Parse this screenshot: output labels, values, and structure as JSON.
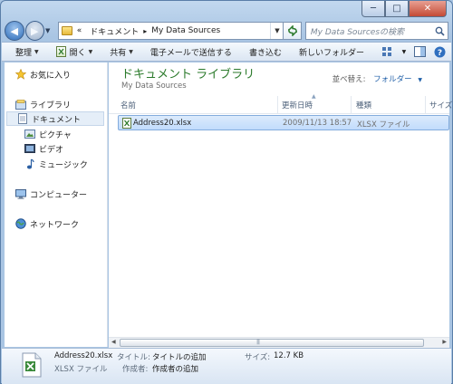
{
  "window": {
    "caption": {
      "minimize": "─",
      "maximize": "□",
      "close": "✕"
    }
  },
  "nav": {
    "back_icon": "back-arrow-icon",
    "forward_icon": "forward-arrow-icon",
    "address": {
      "prefix": "«",
      "crumb1": "ドキュメント",
      "sep": "▸",
      "crumb2": "My Data Sources"
    },
    "search_placeholder": "My Data Sourcesの検索"
  },
  "toolbar": {
    "organize": "整理",
    "open": "開く",
    "share": "共有",
    "email": "電子メールで送信する",
    "burn": "書き込む",
    "new_folder": "新しいフォルダー"
  },
  "sidebar": {
    "favorites": "お気に入り",
    "libraries": "ライブラリ",
    "documents": "ドキュメント",
    "pictures": "ピクチャ",
    "videos": "ビデオ",
    "music": "ミュージック",
    "computer": "コンピューター",
    "network": "ネットワーク"
  },
  "content": {
    "library_title": "ドキュメント ライブラリ",
    "library_subtitle": "My Data Sources",
    "arrange_label": "並べ替え:",
    "arrange_value": "フォルダー",
    "columns": {
      "name": "名前",
      "modified": "更新日時",
      "type": "種類",
      "size": "サイズ"
    },
    "files": [
      {
        "name": "Address20.xlsx",
        "modified": "2009/11/13 18:57",
        "type": "XLSX ファイル"
      }
    ]
  },
  "details": {
    "file_name": "Address20.xlsx",
    "file_type": "XLSX ファイル",
    "title_label": "タイトル:",
    "title_value": "タイトルの追加",
    "author_label": "作成者:",
    "author_value": "作成者の追加",
    "size_label": "サイズ:",
    "size_value": "12.7 KB"
  },
  "colors": {
    "library_title": "#2b7a2b",
    "link_blue": "#1f5fa8",
    "selection": "#c1dcfc"
  }
}
